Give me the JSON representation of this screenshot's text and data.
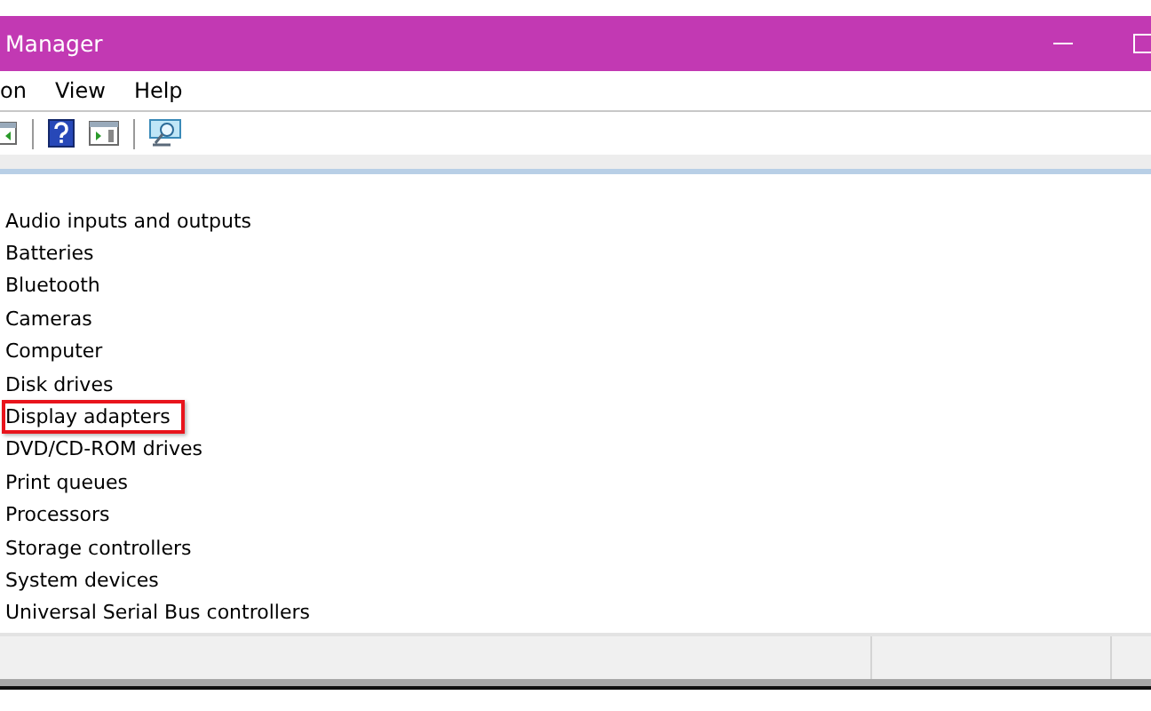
{
  "window": {
    "title": "Manager"
  },
  "menu": [
    "on",
    "View",
    "Help"
  ],
  "device_categories": [
    {
      "label": "Audio inputs and outputs",
      "highlighted": false
    },
    {
      "label": "Batteries",
      "highlighted": false
    },
    {
      "label": "Bluetooth",
      "highlighted": false
    },
    {
      "label": "Cameras",
      "highlighted": false
    },
    {
      "label": "Computer",
      "highlighted": false
    },
    {
      "label": "Disk drives",
      "highlighted": false
    },
    {
      "label": "Display adapters",
      "highlighted": true
    },
    {
      "label": "DVD/CD-ROM drives",
      "highlighted": false
    },
    {
      "label": "Print queues",
      "highlighted": false
    },
    {
      "label": "Processors",
      "highlighted": false
    },
    {
      "label": "Storage controllers",
      "highlighted": false
    },
    {
      "label": "System devices",
      "highlighted": false
    },
    {
      "label": "Universal Serial Bus controllers",
      "highlighted": false
    }
  ]
}
